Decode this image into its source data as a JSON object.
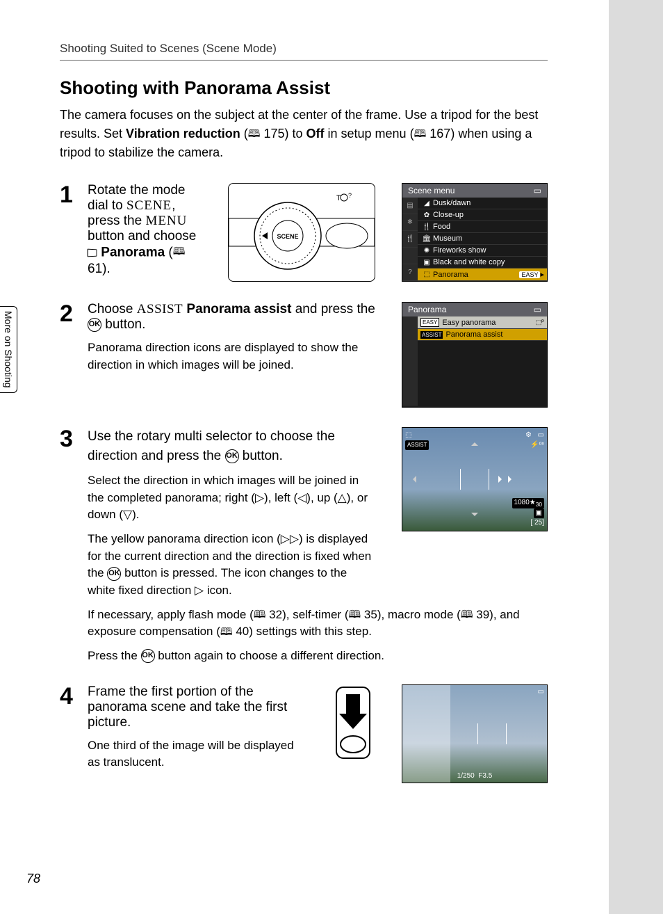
{
  "breadcrumb": "Shooting Suited to Scenes (Scene Mode)",
  "heading": "Shooting with Panorama Assist",
  "intro_a": "The camera focuses on the subject at the center of the frame. Use a tripod for the best results. Set ",
  "intro_b_bold": "Vibration reduction",
  "intro_c": " (",
  "intro_ref1": "175",
  "intro_d": ") to ",
  "intro_e_bold": "Off",
  "intro_f": " in setup menu (",
  "intro_ref2": "167",
  "intro_g": ") when using a tripod to stabilize the camera.",
  "sidetab": "More on Shooting",
  "pagenum": "78",
  "step1": {
    "num": "1",
    "t1": "Rotate the mode dial to ",
    "scene_word": "SCENE",
    "t2": ", press the ",
    "menu_word": "MENU",
    "t3": " button and choose ",
    "pano_bold": "Panorama",
    "t4": " (",
    "ref": "61",
    "t5": ")."
  },
  "scene_menu": {
    "title": "Scene menu",
    "items": [
      "Dusk/dawn",
      "Close-up",
      "Food",
      "Museum",
      "Fireworks show",
      "Black and white copy",
      "Panorama"
    ],
    "easy": "EASY"
  },
  "step2": {
    "num": "2",
    "t1": "Choose ",
    "assist_word": "ASSIST",
    "t2_bold": "Panorama assist",
    "t3": " and press the ",
    "t4": " button.",
    "detail": "Panorama direction icons are displayed to show the direction in which images will be joined."
  },
  "panorama_menu": {
    "title": "Panorama",
    "row1_tag": "EASY",
    "row1": "Easy panorama",
    "row2_tag": "ASSIST",
    "row2": "Panorama assist"
  },
  "step3": {
    "num": "3",
    "title_a": "Use the rotary multi selector to choose the direction and press the ",
    "title_b": " button.",
    "p1": "Select the direction in which images will be joined in the completed panorama; right (▷), left (◁), up (△), or down (▽).",
    "p2a": "The yellow panorama direction icon (▷▷) is displayed for the current direction and the direction is fixed when the ",
    "p2b": " button is pressed. The icon changes to the white fixed direction ▷ icon.",
    "p3a": "If necessary, apply flash mode (",
    "ref_a": "32",
    "p3b": "), self-timer (",
    "ref_b": "35",
    "p3c": "), macro mode (",
    "ref_c": "39",
    "p3d": "), and exposure compensation (",
    "ref_d": "40",
    "p3e": ") settings with this step.",
    "p4a": "Press the ",
    "p4b": " button again to choose a different direction."
  },
  "preview": {
    "assist": "ASSIST",
    "counter": "[    25]",
    "res": "1080",
    "hd": "30"
  },
  "step4": {
    "num": "4",
    "title": "Frame the first portion of the panorama scene and take the first picture.",
    "detail": "One third of the image will be displayed as translucent."
  },
  "preview2": {
    "shutter": "1/250",
    "aperture": "F3.5"
  }
}
